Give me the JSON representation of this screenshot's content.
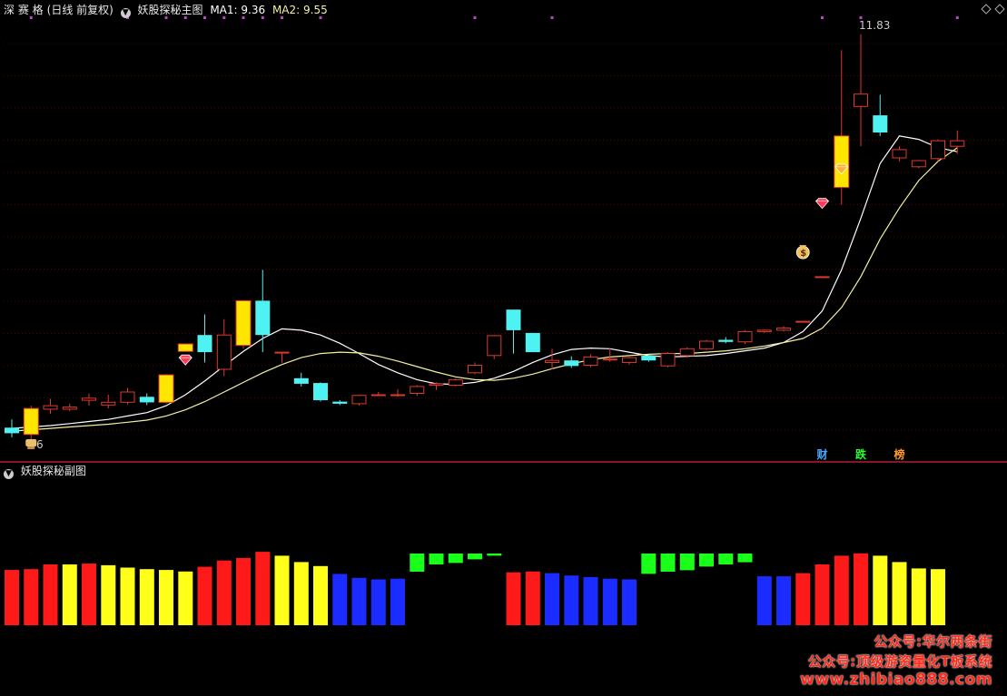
{
  "header_main": {
    "symbol": "深 赛 格",
    "period": "(日线 前复权)",
    "indicator": "妖股探秘主图",
    "ma1_label": "MA1: 9.36",
    "ma2_label": "MA2: 9.55",
    "toggle_icon": "circle-chevron-down-icon"
  },
  "header_sub": {
    "indicator": "妖股探秘副图",
    "toggle_icon": "circle-chevron-down-icon"
  },
  "corner_icons": [
    "diamond-outline-icon",
    "diamond-outline-icon"
  ],
  "colors": {
    "background": "#000000",
    "up": "#e0392b",
    "down": "#4ff2f2",
    "special": "#ffe600",
    "ma1": "#ffffff",
    "ma2": "#f5f0a0",
    "grid": "#5a0000",
    "sub_red": "#ff1a1a",
    "sub_yellow": "#ffff1a",
    "sub_blue": "#1a2cff",
    "sub_green": "#1aff1a",
    "watermark": "#ff2a1a"
  },
  "chart_data": {
    "type": "candlestick",
    "price_high_label": "11.83",
    "price_low_label": "6",
    "ylim": [
      5.8,
      12.0
    ],
    "candles": [
      {
        "o": 6.1,
        "h": 6.22,
        "l": 5.96,
        "c": 6.02,
        "k": "down"
      },
      {
        "o": 6.0,
        "h": 6.42,
        "l": 5.93,
        "c": 6.38,
        "k": "special"
      },
      {
        "o": 6.37,
        "h": 6.52,
        "l": 6.3,
        "c": 6.42,
        "k": "up"
      },
      {
        "o": 6.37,
        "h": 6.45,
        "l": 6.34,
        "c": 6.4,
        "k": "up"
      },
      {
        "o": 6.5,
        "h": 6.6,
        "l": 6.42,
        "c": 6.53,
        "k": "up"
      },
      {
        "o": 6.43,
        "h": 6.58,
        "l": 6.38,
        "c": 6.47,
        "k": "up"
      },
      {
        "o": 6.47,
        "h": 6.68,
        "l": 6.44,
        "c": 6.62,
        "k": "up"
      },
      {
        "o": 6.55,
        "h": 6.6,
        "l": 6.43,
        "c": 6.47,
        "k": "down"
      },
      {
        "o": 6.47,
        "h": 6.88,
        "l": 6.45,
        "c": 6.87,
        "k": "special"
      },
      {
        "o": 7.32,
        "h": 7.32,
        "l": 7.21,
        "c": 7.21,
        "k": "special"
      },
      {
        "o": 7.45,
        "h": 7.75,
        "l": 7.05,
        "c": 7.2,
        "k": "down"
      },
      {
        "o": 6.95,
        "h": 7.68,
        "l": 6.85,
        "c": 7.45,
        "k": "up"
      },
      {
        "o": 7.3,
        "h": 7.96,
        "l": 7.25,
        "c": 7.95,
        "k": "special"
      },
      {
        "o": 7.95,
        "h": 8.4,
        "l": 7.2,
        "c": 7.45,
        "k": "down"
      },
      {
        "o": 7.2,
        "h": 7.2,
        "l": 7.05,
        "c": 7.2,
        "k": "up"
      },
      {
        "o": 6.82,
        "h": 6.9,
        "l": 6.7,
        "c": 6.74,
        "k": "down"
      },
      {
        "o": 6.75,
        "h": 6.76,
        "l": 6.48,
        "c": 6.5,
        "k": "down"
      },
      {
        "o": 6.48,
        "h": 6.5,
        "l": 6.43,
        "c": 6.45,
        "k": "down"
      },
      {
        "o": 6.45,
        "h": 6.58,
        "l": 6.42,
        "c": 6.57,
        "k": "up"
      },
      {
        "o": 6.58,
        "h": 6.62,
        "l": 6.56,
        "c": 6.58,
        "k": "up"
      },
      {
        "o": 6.58,
        "h": 6.66,
        "l": 6.55,
        "c": 6.58,
        "k": "up"
      },
      {
        "o": 6.6,
        "h": 6.72,
        "l": 6.56,
        "c": 6.7,
        "k": "up"
      },
      {
        "o": 6.72,
        "h": 6.76,
        "l": 6.65,
        "c": 6.74,
        "k": "up"
      },
      {
        "o": 6.72,
        "h": 6.82,
        "l": 6.7,
        "c": 6.8,
        "k": "up"
      },
      {
        "o": 6.9,
        "h": 7.05,
        "l": 6.88,
        "c": 7.01,
        "k": "up"
      },
      {
        "o": 7.15,
        "h": 7.45,
        "l": 7.1,
        "c": 7.44,
        "k": "up"
      },
      {
        "o": 7.82,
        "h": 7.82,
        "l": 7.18,
        "c": 7.52,
        "k": "down"
      },
      {
        "o": 7.48,
        "h": 7.48,
        "l": 7.2,
        "c": 7.2,
        "k": "down"
      },
      {
        "o": 7.05,
        "h": 7.25,
        "l": 6.95,
        "c": 7.08,
        "k": "up"
      },
      {
        "o": 7.08,
        "h": 7.14,
        "l": 6.97,
        "c": 7.0,
        "k": "down"
      },
      {
        "o": 7.01,
        "h": 7.17,
        "l": 6.98,
        "c": 7.13,
        "k": "up"
      },
      {
        "o": 7.1,
        "h": 7.26,
        "l": 7.06,
        "c": 7.1,
        "k": "up"
      },
      {
        "o": 7.05,
        "h": 7.15,
        "l": 7.02,
        "c": 7.12,
        "k": "up"
      },
      {
        "o": 7.15,
        "h": 7.15,
        "l": 7.06,
        "c": 7.08,
        "k": "down"
      },
      {
        "o": 7.0,
        "h": 7.2,
        "l": 6.98,
        "c": 7.18,
        "k": "up"
      },
      {
        "o": 7.15,
        "h": 7.27,
        "l": 7.12,
        "c": 7.25,
        "k": "up"
      },
      {
        "o": 7.25,
        "h": 7.38,
        "l": 7.23,
        "c": 7.36,
        "k": "up"
      },
      {
        "o": 7.38,
        "h": 7.42,
        "l": 7.33,
        "c": 7.35,
        "k": "down"
      },
      {
        "o": 7.35,
        "h": 7.52,
        "l": 7.32,
        "c": 7.5,
        "k": "up"
      },
      {
        "o": 7.5,
        "h": 7.53,
        "l": 7.48,
        "c": 7.52,
        "k": "up"
      },
      {
        "o": 7.52,
        "h": 7.58,
        "l": 7.5,
        "c": 7.55,
        "k": "up"
      },
      {
        "o": 7.65,
        "h": 7.65,
        "l": 7.65,
        "c": 7.65,
        "k": "up"
      },
      {
        "o": 8.3,
        "h": 8.3,
        "l": 8.3,
        "c": 8.3,
        "k": "up"
      },
      {
        "o": 9.6,
        "h": 11.6,
        "l": 9.35,
        "c": 10.35,
        "k": "special"
      },
      {
        "o": 10.78,
        "h": 11.83,
        "l": 10.2,
        "c": 10.96,
        "k": "up"
      },
      {
        "o": 10.65,
        "h": 10.95,
        "l": 10.35,
        "c": 10.4,
        "k": "down"
      },
      {
        "o": 10.15,
        "h": 10.2,
        "l": 9.98,
        "c": 10.03,
        "k": "up"
      },
      {
        "o": 9.9,
        "h": 10.0,
        "l": 9.88,
        "c": 9.99,
        "k": "up"
      },
      {
        "o": 10.02,
        "h": 10.3,
        "l": 9.98,
        "c": 10.28,
        "k": "up"
      },
      {
        "o": 10.28,
        "h": 10.43,
        "l": 10.09,
        "c": 10.2,
        "k": "up"
      }
    ],
    "ma1": [
      6.09,
      6.11,
      6.13,
      6.16,
      6.19,
      6.22,
      6.27,
      6.32,
      6.42,
      6.58,
      6.78,
      7.0,
      7.21,
      7.4,
      7.54,
      7.52,
      7.45,
      7.33,
      7.18,
      7.02,
      6.9,
      6.8,
      6.74,
      6.73,
      6.76,
      6.82,
      6.92,
      7.05,
      7.16,
      7.24,
      7.26,
      7.25,
      7.2,
      7.15,
      7.13,
      7.14,
      7.15,
      7.18,
      7.22,
      7.26,
      7.34,
      7.5,
      7.8,
      8.4,
      9.15,
      9.95,
      10.35,
      10.3,
      10.18,
      10.12
    ],
    "ma2": [
      6.05,
      6.07,
      6.09,
      6.11,
      6.13,
      6.15,
      6.18,
      6.21,
      6.27,
      6.36,
      6.48,
      6.62,
      6.76,
      6.9,
      7.02,
      7.12,
      7.18,
      7.2,
      7.19,
      7.14,
      7.07,
      6.99,
      6.91,
      6.84,
      6.8,
      6.79,
      6.82,
      6.88,
      6.96,
      7.03,
      7.09,
      7.13,
      7.15,
      7.17,
      7.18,
      7.18,
      7.2,
      7.22,
      7.25,
      7.29,
      7.34,
      7.4,
      7.55,
      7.85,
      8.3,
      8.85,
      9.3,
      9.7,
      9.98,
      10.18
    ],
    "markers": [
      {
        "i": 9,
        "type": "gem-red-icon",
        "price": 7.08
      },
      {
        "i": 42,
        "type": "gem-red-icon",
        "price": 9.36
      },
      {
        "i": 43,
        "type": "gem-gold-icon",
        "price": 9.86
      },
      {
        "i": 41,
        "type": "money-bag-icon",
        "price": 8.68
      },
      {
        "i": 1,
        "type": "trophy-icon",
        "price": 5.88
      }
    ],
    "signal_labels": [
      {
        "i": 42,
        "text": "财",
        "color": "#4aa8ff"
      },
      {
        "i": 44,
        "text": "跌",
        "color": "#2cff2c"
      },
      {
        "i": 46,
        "text": "榜",
        "color": "#ff9a2a"
      }
    ],
    "top_dots": [
      1,
      6,
      8,
      9,
      10,
      11,
      12,
      13,
      14,
      16,
      24,
      28,
      42,
      44,
      49
    ],
    "sub": {
      "type": "bar",
      "bars": [
        {
          "i": 0,
          "v": 0.7,
          "c": "red"
        },
        {
          "i": 1,
          "v": 0.71,
          "c": "red"
        },
        {
          "i": 2,
          "v": 0.77,
          "c": "red"
        },
        {
          "i": 3,
          "v": 0.77,
          "c": "yellow"
        },
        {
          "i": 4,
          "v": 0.78,
          "c": "red"
        },
        {
          "i": 5,
          "v": 0.76,
          "c": "yellow"
        },
        {
          "i": 6,
          "v": 0.73,
          "c": "yellow"
        },
        {
          "i": 7,
          "v": 0.71,
          "c": "yellow"
        },
        {
          "i": 8,
          "v": 0.7,
          "c": "yellow"
        },
        {
          "i": 9,
          "v": 0.68,
          "c": "yellow"
        },
        {
          "i": 10,
          "v": 0.74,
          "c": "red"
        },
        {
          "i": 11,
          "v": 0.82,
          "c": "red"
        },
        {
          "i": 12,
          "v": 0.85,
          "c": "red"
        },
        {
          "i": 13,
          "v": 0.93,
          "c": "red"
        },
        {
          "i": 14,
          "v": 0.88,
          "c": "yellow"
        },
        {
          "i": 15,
          "v": 0.8,
          "c": "yellow"
        },
        {
          "i": 16,
          "v": 0.75,
          "c": "yellow"
        },
        {
          "i": 17,
          "v": 0.65,
          "c": "blue"
        },
        {
          "i": 18,
          "v": 0.6,
          "c": "blue"
        },
        {
          "i": 19,
          "v": 0.58,
          "c": "blue"
        },
        {
          "i": 20,
          "v": 0.59,
          "c": "blue"
        },
        {
          "i": 21,
          "v": -0.25,
          "c": "green"
        },
        {
          "i": 22,
          "v": -0.15,
          "c": "green"
        },
        {
          "i": 23,
          "v": -0.13,
          "c": "green"
        },
        {
          "i": 24,
          "v": -0.08,
          "c": "green"
        },
        {
          "i": 25,
          "v": -0.03,
          "c": "green"
        },
        {
          "i": 26,
          "v": 0.67,
          "c": "red"
        },
        {
          "i": 27,
          "v": 0.68,
          "c": "red"
        },
        {
          "i": 28,
          "v": 0.66,
          "c": "blue"
        },
        {
          "i": 29,
          "v": 0.63,
          "c": "blue"
        },
        {
          "i": 30,
          "v": 0.61,
          "c": "blue"
        },
        {
          "i": 31,
          "v": 0.59,
          "c": "blue"
        },
        {
          "i": 32,
          "v": 0.58,
          "c": "blue"
        },
        {
          "i": 33,
          "v": -0.28,
          "c": "green"
        },
        {
          "i": 34,
          "v": -0.25,
          "c": "green"
        },
        {
          "i": 35,
          "v": -0.23,
          "c": "green"
        },
        {
          "i": 36,
          "v": -0.18,
          "c": "green"
        },
        {
          "i": 37,
          "v": -0.15,
          "c": "green"
        },
        {
          "i": 38,
          "v": -0.12,
          "c": "green"
        },
        {
          "i": 39,
          "v": 0.62,
          "c": "blue"
        },
        {
          "i": 40,
          "v": 0.62,
          "c": "blue"
        },
        {
          "i": 41,
          "v": 0.66,
          "c": "red"
        },
        {
          "i": 42,
          "v": 0.77,
          "c": "red"
        },
        {
          "i": 43,
          "v": 0.88,
          "c": "red"
        },
        {
          "i": 44,
          "v": 0.91,
          "c": "red"
        },
        {
          "i": 45,
          "v": 0.88,
          "c": "yellow"
        },
        {
          "i": 46,
          "v": 0.8,
          "c": "yellow"
        },
        {
          "i": 47,
          "v": 0.72,
          "c": "yellow"
        },
        {
          "i": 48,
          "v": 0.71,
          "c": "yellow"
        }
      ]
    }
  },
  "watermark": {
    "line1": "公众号:华尔两条街",
    "line2": "公众号:顶级游资量化T板系统",
    "line3": "www.zhibiao888.com"
  }
}
